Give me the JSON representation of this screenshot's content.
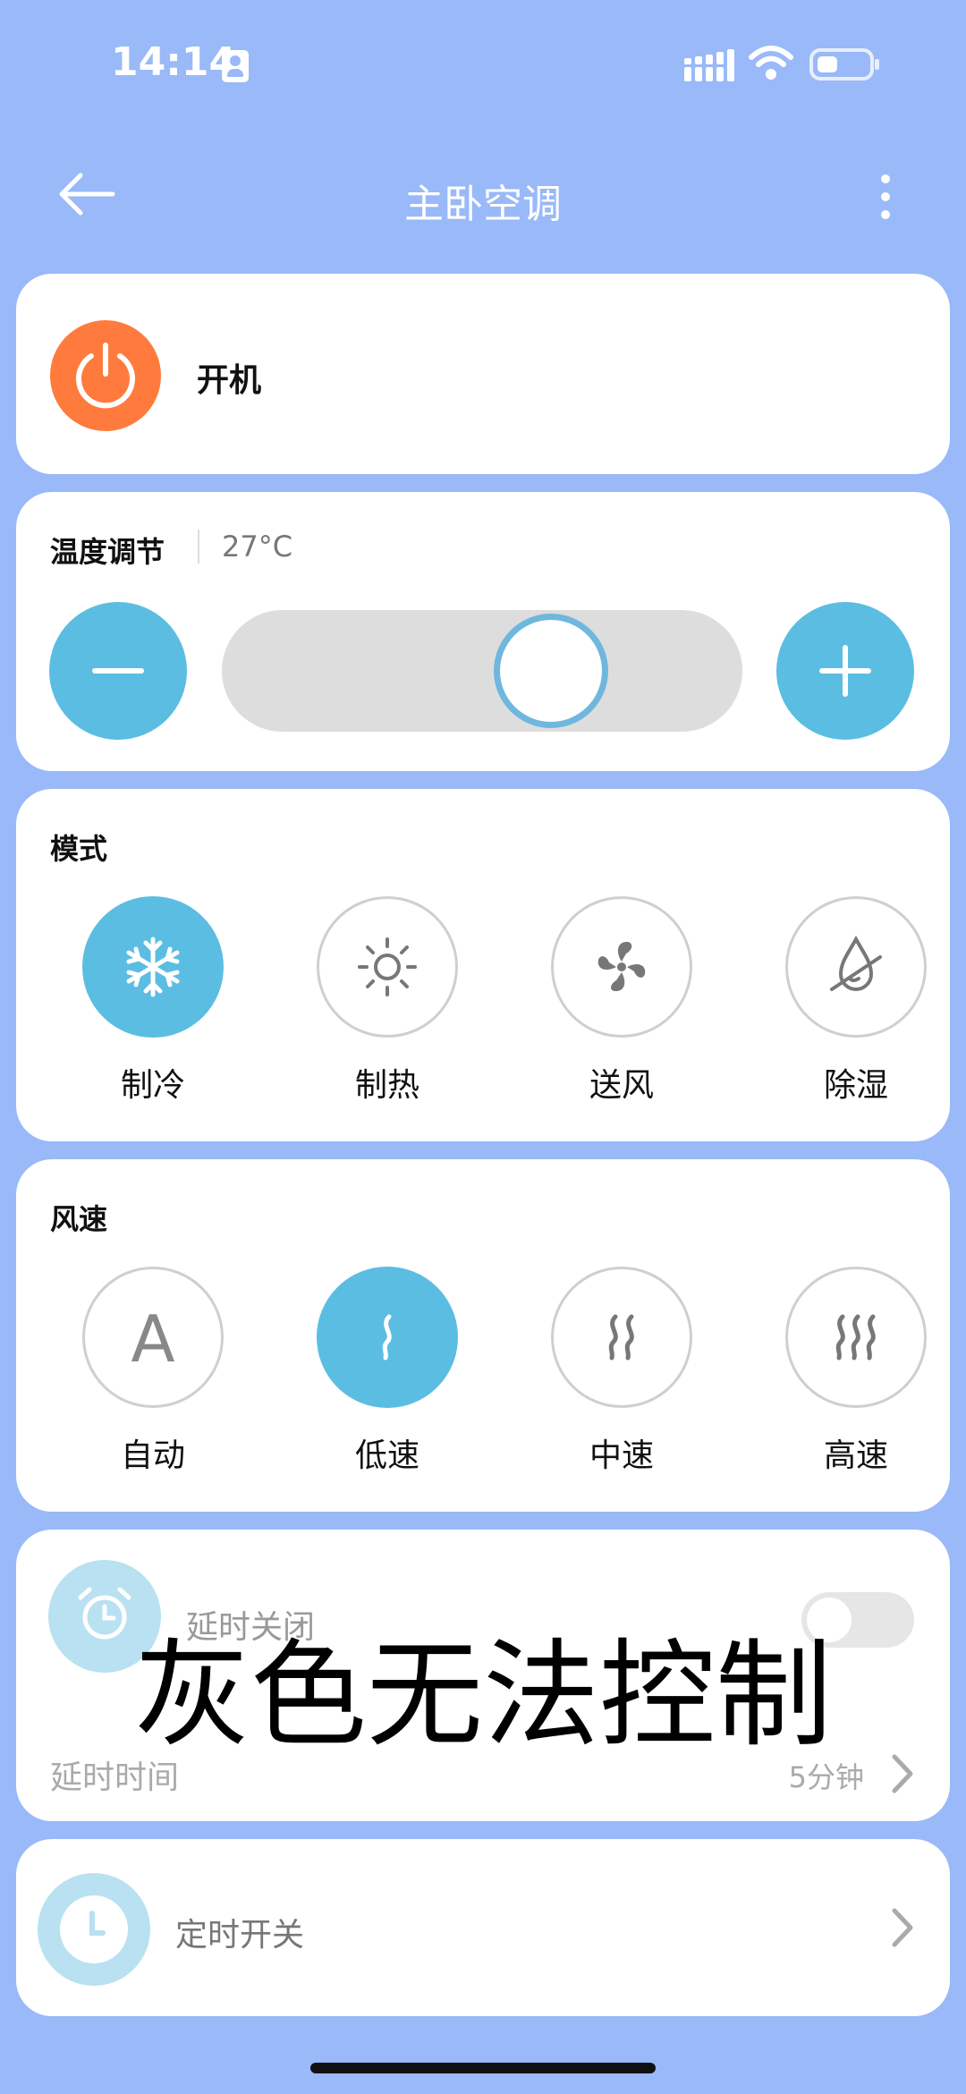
{
  "status_bar": {
    "time": "14:14"
  },
  "header": {
    "title": "主卧空调"
  },
  "power": {
    "label": "开机"
  },
  "temperature": {
    "title": "温度调节",
    "value": "27°C"
  },
  "mode": {
    "title": "模式",
    "items": [
      {
        "label": "制冷",
        "icon": "snowflake-icon",
        "active": true
      },
      {
        "label": "制热",
        "icon": "sun-icon",
        "active": false
      },
      {
        "label": "送风",
        "icon": "fan-icon",
        "active": false
      },
      {
        "label": "除湿",
        "icon": "dehumidify-drop-icon",
        "active": false
      }
    ]
  },
  "fan_speed": {
    "title": "风速",
    "items": [
      {
        "label": "自动",
        "symbol": "A",
        "icon": "auto-letter-icon",
        "active": false
      },
      {
        "label": "低速",
        "icon": "wind-low-icon",
        "active": true
      },
      {
        "label": "中速",
        "icon": "wind-mid-icon",
        "active": false
      },
      {
        "label": "高速",
        "icon": "wind-high-icon",
        "active": false
      }
    ]
  },
  "delay_off": {
    "title": "延时关闭",
    "enabled": false,
    "time_label": "延时时间",
    "time_value": "5分钟"
  },
  "overlay": {
    "text": "灰色无法控制"
  },
  "schedule": {
    "label": "定时开关"
  },
  "colors": {
    "background": "#99b9f8",
    "accent": "#5bbde2",
    "power": "#ff7b3d",
    "faded_accent": "#b9e1f2"
  }
}
